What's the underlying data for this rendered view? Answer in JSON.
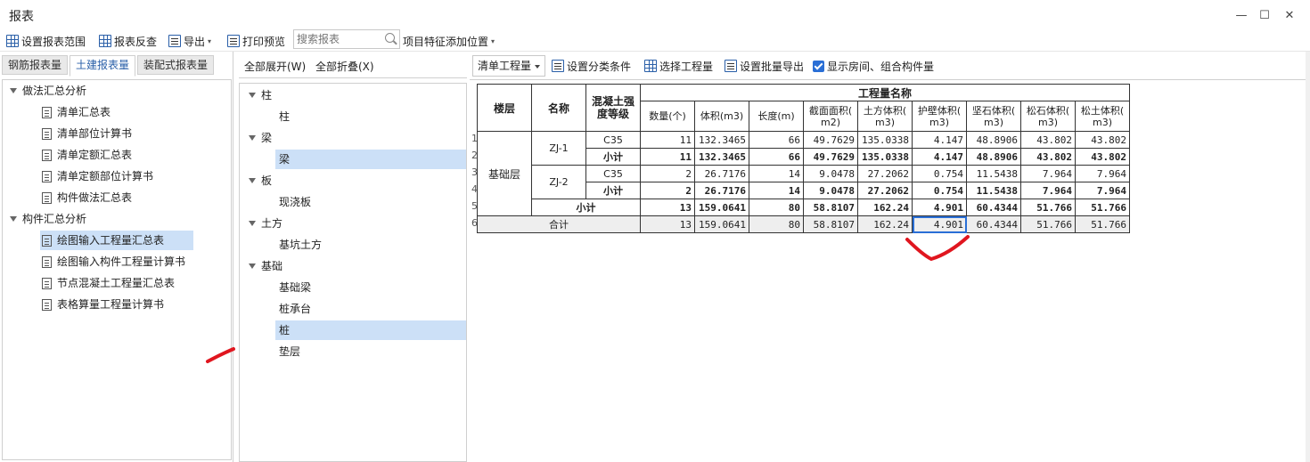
{
  "window": {
    "title": "报表",
    "minimize": "—",
    "maximize": "☐",
    "close": "✕"
  },
  "toolbar": {
    "set_range": "设置报表范围",
    "report_query": "报表反查",
    "export": "导出",
    "print_preview": "打印预览",
    "search_placeholder": "搜索报表",
    "item_feature": "项目特征添加位置"
  },
  "left": {
    "tabs": [
      "钢筋报表量",
      "土建报表量",
      "装配式报表量"
    ],
    "groups": [
      {
        "label": "做法汇总分析",
        "items": [
          "清单汇总表",
          "清单部位计算书",
          "清单定额汇总表",
          "清单定额部位计算书",
          "构件做法汇总表"
        ]
      },
      {
        "label": "构件汇总分析",
        "items": [
          "绘图输入工程量汇总表",
          "绘图输入构件工程量计算书",
          "节点混凝土工程量汇总表",
          "表格算量工程量计算书"
        ]
      }
    ]
  },
  "middle": {
    "expand_all": "全部展开(W)",
    "collapse_all": "全部折叠(X)",
    "tree": [
      {
        "label": "柱",
        "children": [
          "柱"
        ]
      },
      {
        "label": "梁",
        "children": [
          "梁"
        ]
      },
      {
        "label": "板",
        "children": [
          "现浇板"
        ]
      },
      {
        "label": "土方",
        "children": [
          "基坑土方"
        ]
      },
      {
        "label": "基础",
        "children": [
          "基础梁",
          "桩承台",
          "桩",
          "垫层"
        ]
      }
    ]
  },
  "right": {
    "dropdown": "清单工程量",
    "set_category": "设置分类条件",
    "select_quantity": "选择工程量",
    "batch_export": "设置批量导出",
    "show_rooms": "显示房间、组合构件量",
    "table": {
      "h_floor": "楼层",
      "h_name": "名称",
      "h_grade_1": "混凝土强",
      "h_grade_2": "度等级",
      "h_group": "工程量名称",
      "cols": [
        {
          "a": "数量(个)",
          "b": ""
        },
        {
          "a": "体积(m3)",
          "b": ""
        },
        {
          "a": "长度(m)",
          "b": ""
        },
        {
          "a": "截面面积(",
          "b": "m2)"
        },
        {
          "a": "土方体积(",
          "b": "m3)"
        },
        {
          "a": "护壁体积(",
          "b": "m3)"
        },
        {
          "a": "坚石体积(",
          "b": "m3)"
        },
        {
          "a": "松石体积(",
          "b": "m3)"
        },
        {
          "a": "松土体积(",
          "b": "m3)"
        }
      ],
      "floor": "基础层",
      "zj1": "ZJ-1",
      "zj2": "ZJ-2",
      "c35": "C35",
      "subtotal": "小计",
      "total": "合计",
      "rownums": [
        "1",
        "2",
        "3",
        "4",
        "5",
        "6"
      ],
      "r1": [
        "11",
        "132.3465",
        "66",
        "49.7629",
        "135.0338",
        "4.147",
        "48.8906",
        "43.802",
        "43.802"
      ],
      "r2": [
        "11",
        "132.3465",
        "66",
        "49.7629",
        "135.0338",
        "4.147",
        "48.8906",
        "43.802",
        "43.802"
      ],
      "r3": [
        "2",
        "26.7176",
        "14",
        "9.0478",
        "27.2062",
        "0.754",
        "11.5438",
        "7.964",
        "7.964"
      ],
      "r4": [
        "2",
        "26.7176",
        "14",
        "9.0478",
        "27.2062",
        "0.754",
        "11.5438",
        "7.964",
        "7.964"
      ],
      "r5": [
        "13",
        "159.0641",
        "80",
        "58.8107",
        "162.24",
        "4.901",
        "60.4344",
        "51.766",
        "51.766"
      ],
      "r6": [
        "13",
        "159.0641",
        "80",
        "58.8107",
        "162.24",
        "4.901",
        "60.4344",
        "51.766",
        "51.766"
      ]
    }
  },
  "colors": {
    "accent": "#2a6fd6",
    "selection": "#cce0f7",
    "annotation": "#e0161f"
  }
}
